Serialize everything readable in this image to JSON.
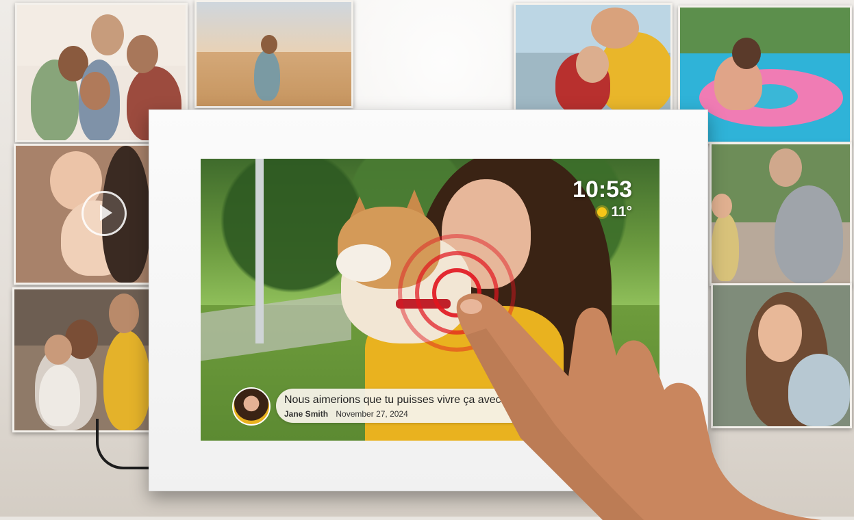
{
  "screen": {
    "time": "10:53",
    "temperature": "11°",
    "weather_icon": "sun-icon"
  },
  "message": {
    "text": "Nous aimerions que tu puisses vivre ça avec nous !",
    "author": "Jane Smith",
    "date": "November 27, 2024"
  },
  "colors": {
    "frame": "#f5f5f5",
    "ripple": "#e0141e",
    "bubble": "#f5f2e8"
  }
}
